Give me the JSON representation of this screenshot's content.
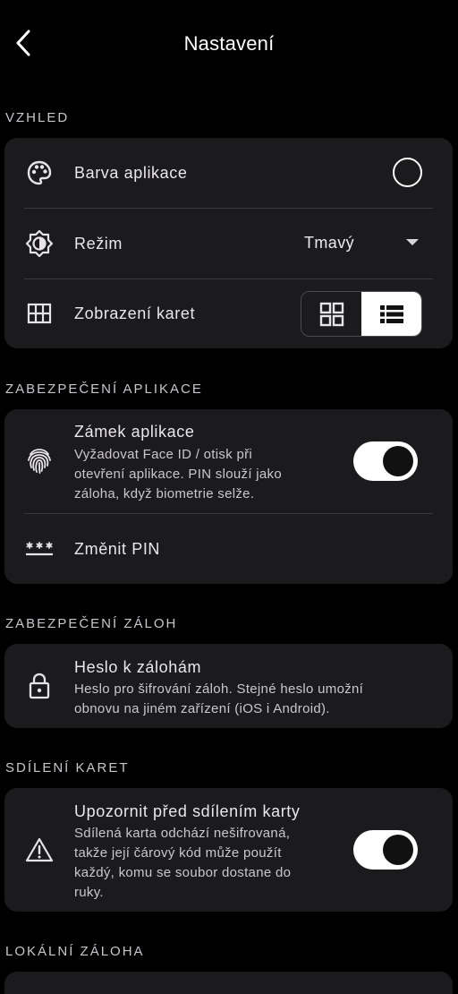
{
  "header": {
    "title": "Nastavení"
  },
  "sections": {
    "appearance": {
      "title": "VZHLED",
      "app_color_label": "Barva aplikace",
      "mode_label": "Režim",
      "mode_value": "Tmavý",
      "card_view_label": "Zobrazení karet",
      "card_view_selected": "list"
    },
    "app_security": {
      "title": "ZABEZPEČENÍ APLIKACE",
      "app_lock_label": "Zámek aplikace",
      "app_lock_sub1": "Vyžadovat Face ID / otisk při",
      "app_lock_sub2": "otevření aplikace. PIN slouží jako",
      "app_lock_sub3": "záloha, když biometrie selže.",
      "app_lock_enabled": true,
      "change_pin_label": "Změnit PIN"
    },
    "backup_security": {
      "title": "ZABEZPEČENÍ ZÁLOH",
      "backup_password_label": "Heslo k zálohám",
      "backup_password_sub1": "Heslo pro šifrování záloh. Stejné heslo umožní",
      "backup_password_sub2": "obnovu na jiném zařízení (iOS i Android)."
    },
    "card_sharing": {
      "title": "SDÍLENÍ KARET",
      "warn_label": "Upozornit před sdílením karty",
      "warn_sub1": "Sdílená karta odchází nešifrovaná,",
      "warn_sub2": "takže její čárový kód může použít",
      "warn_sub3": "každý, komu se soubor dostane do",
      "warn_sub4": "ruky.",
      "warn_enabled": true
    },
    "local_backup": {
      "title": "LOKÁLNÍ ZÁLOHA"
    }
  },
  "icons": {
    "back": "chevron-left-icon",
    "app_color": "palette-icon",
    "mode": "brightness-icon",
    "card_view": "grid-icon",
    "app_lock": "fingerprint-icon",
    "change_pin": "password-icon",
    "backup_password": "lock-icon",
    "warn": "warning-icon"
  },
  "colors": {
    "background": "#000000",
    "card": "#1b1b1d",
    "text": "#ffffff",
    "toggle_on": "#ffffff"
  }
}
